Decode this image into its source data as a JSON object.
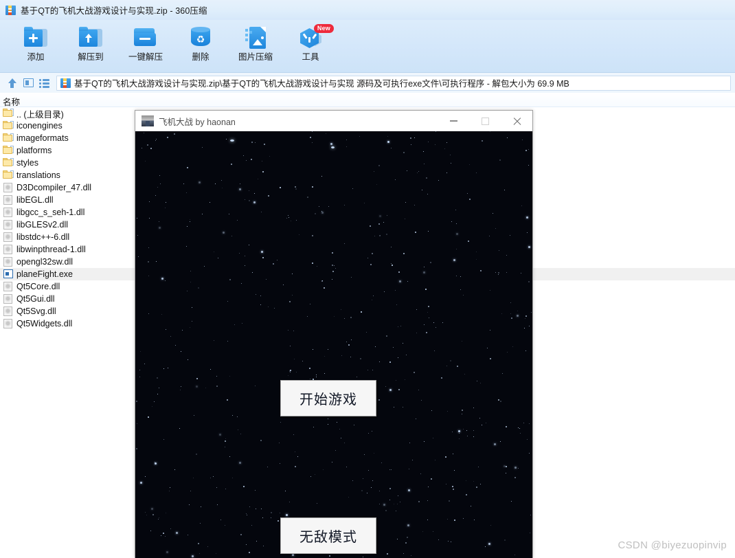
{
  "app": {
    "title": "基于QT的飞机大战游戏设计与实现.zip - 360压缩",
    "title_icon": "zip-archive-icon"
  },
  "toolbar": {
    "buttons": [
      {
        "label": "添加",
        "icon": "folder-add-icon",
        "badge": ""
      },
      {
        "label": "解压到",
        "icon": "folder-extract-icon",
        "badge": ""
      },
      {
        "label": "一键解压",
        "icon": "open-folder-icon",
        "badge": ""
      },
      {
        "label": "删除",
        "icon": "trash-recycle-icon",
        "badge": ""
      },
      {
        "label": "图片压缩",
        "icon": "image-compress-icon",
        "badge": ""
      },
      {
        "label": "工具",
        "icon": "tools-hexagon-icon",
        "badge": "New"
      }
    ]
  },
  "pathbar": {
    "up_icon": "up-arrow-icon",
    "panel_icon": "preview-panel-icon",
    "list_icon": "list-view-icon",
    "archive_icon": "zip-archive-icon",
    "path": "基于QT的飞机大战游戏设计与实现.zip\\基于QT的飞机大战游戏设计与实现 源码及可执行exe文件\\可执行程序 - 解包大小为 69.9 MB"
  },
  "filelist": {
    "columns": [
      "名称"
    ],
    "rows": [
      {
        "name": ".. (上级目录)",
        "icon": "folder-icon",
        "type": "parent",
        "selected": false
      },
      {
        "name": "iconengines",
        "icon": "folder-icon",
        "type": "folder",
        "selected": false
      },
      {
        "name": "imageformats",
        "icon": "folder-icon",
        "type": "folder",
        "selected": false
      },
      {
        "name": "platforms",
        "icon": "folder-icon",
        "type": "folder",
        "selected": false
      },
      {
        "name": "styles",
        "icon": "folder-icon",
        "type": "folder",
        "selected": false
      },
      {
        "name": "translations",
        "icon": "folder-icon",
        "type": "folder",
        "selected": false
      },
      {
        "name": "D3Dcompiler_47.dll",
        "icon": "dll-file-icon",
        "type": "file",
        "selected": false
      },
      {
        "name": "libEGL.dll",
        "icon": "dll-file-icon",
        "type": "file",
        "selected": false
      },
      {
        "name": "libgcc_s_seh-1.dll",
        "icon": "dll-file-icon",
        "type": "file",
        "selected": false
      },
      {
        "name": "libGLESv2.dll",
        "icon": "dll-file-icon",
        "type": "file",
        "selected": false
      },
      {
        "name": "libstdc++-6.dll",
        "icon": "dll-file-icon",
        "type": "file",
        "selected": false
      },
      {
        "name": "libwinpthread-1.dll",
        "icon": "dll-file-icon",
        "type": "file",
        "selected": false
      },
      {
        "name": "opengl32sw.dll",
        "icon": "dll-file-icon",
        "type": "file",
        "selected": false
      },
      {
        "name": "planeFight.exe",
        "icon": "exe-file-icon",
        "type": "file",
        "selected": true
      },
      {
        "name": "Qt5Core.dll",
        "icon": "dll-file-icon",
        "type": "file",
        "selected": false
      },
      {
        "name": "Qt5Gui.dll",
        "icon": "dll-file-icon",
        "type": "file",
        "selected": false
      },
      {
        "name": "Qt5Svg.dll",
        "icon": "dll-file-icon",
        "type": "file",
        "selected": false
      },
      {
        "name": "Qt5Widgets.dll",
        "icon": "dll-file-icon",
        "type": "file",
        "selected": false
      }
    ]
  },
  "game_window": {
    "title": "飞机大战 by haonan",
    "title_icon": "plane-game-icon",
    "controls": {
      "minimize": "minimize-icon",
      "maximize": "maximize-icon",
      "close": "close-icon"
    },
    "buttons": [
      {
        "label": "开始游戏"
      },
      {
        "label": "无敌模式"
      }
    ],
    "background": "#04060d"
  },
  "watermark": {
    "text": "CSDN @biyezuopinvip"
  },
  "colors": {
    "chrome_blue": "#d4e7fa",
    "accent_blue": "#2b8bd8",
    "selected_row": "#f0f0f0",
    "game_bg": "#04060d",
    "badge_red": "#ee2b3c"
  }
}
